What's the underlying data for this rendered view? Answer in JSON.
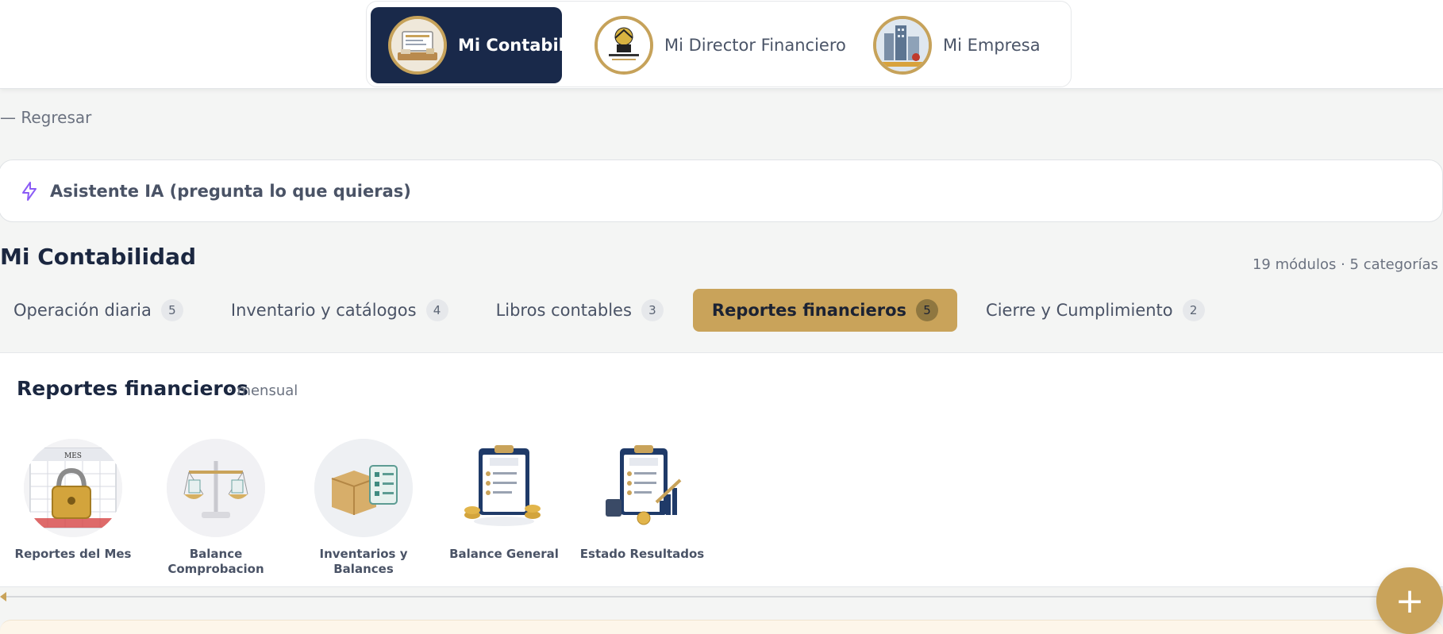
{
  "top_nav": {
    "tabs": [
      {
        "label": "Mi Contabilidad",
        "icon": "accounting-office-avatar",
        "active": true
      },
      {
        "label": "Mi Director Financiero",
        "icon": "financial-director-logo",
        "active": false
      },
      {
        "label": "Mi Empresa",
        "icon": "company-buildings-avatar",
        "active": false
      }
    ]
  },
  "back_link": "— Regresar",
  "ai_assistant": {
    "label": "Asistente IA (pregunta lo que quieras)",
    "icon": "lightning-icon"
  },
  "section": {
    "title": "Mi Contabilidad",
    "summary": "19 módulos · 5 categorías"
  },
  "categories": [
    {
      "label": "Operación diaria",
      "count": "5",
      "active": false
    },
    {
      "label": "Inventario y catálogos",
      "count": "4",
      "active": false
    },
    {
      "label": "Libros contables",
      "count": "3",
      "active": false
    },
    {
      "label": "Reportes financieros",
      "count": "5",
      "active": true
    },
    {
      "label": "Cierre y Cumplimiento",
      "count": "2",
      "active": false
    }
  ],
  "panel": {
    "title": "Reportes financieros",
    "subtitle": "· mensual",
    "modules": [
      {
        "label": "Reportes del Mes",
        "icon": "calendar-lock-icon"
      },
      {
        "label": "Balance Comprobacion",
        "icon": "scale-balance-icon"
      },
      {
        "label": "Inventarios y Balances",
        "icon": "box-checklist-icon"
      },
      {
        "label": "Balance General",
        "icon": "balance-sheet-clipboard-icon"
      },
      {
        "label": "Estado Resultados",
        "icon": "income-statement-clipboard-icon"
      }
    ]
  },
  "fab": {
    "label": "+",
    "icon": "plus-icon"
  },
  "colors": {
    "navy": "#19294a",
    "gold": "#c9a35a",
    "background": "#f4f5f4",
    "text": "#1f2a3c"
  }
}
